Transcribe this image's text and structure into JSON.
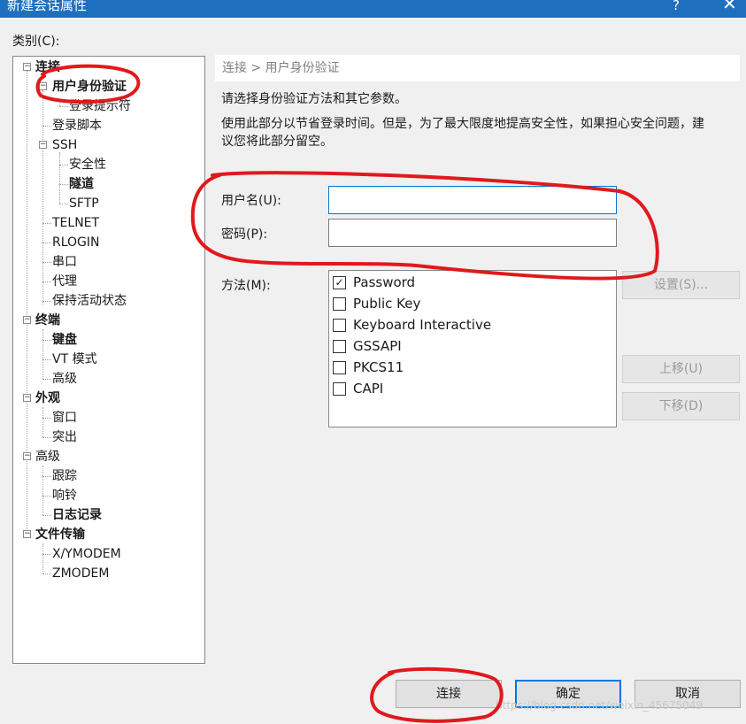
{
  "window": {
    "title": "新建会话属性",
    "help_glyph": "?",
    "close_glyph": "✕"
  },
  "category_label": "类别(C):",
  "tree": {
    "items": [
      {
        "label": "连接",
        "bold": true,
        "expander": "−"
      },
      {
        "label": "用户身份验证",
        "bold": true,
        "expander": "−",
        "selected": true
      },
      {
        "label": "登录提示符"
      },
      {
        "label": "登录脚本"
      },
      {
        "label": "SSH",
        "expander": "−"
      },
      {
        "label": "安全性"
      },
      {
        "label": "隧道",
        "bold": true
      },
      {
        "label": "SFTP"
      },
      {
        "label": "TELNET"
      },
      {
        "label": "RLOGIN"
      },
      {
        "label": "串口"
      },
      {
        "label": "代理"
      },
      {
        "label": "保持活动状态"
      },
      {
        "label": "终端",
        "bold": true,
        "expander": "−"
      },
      {
        "label": "键盘",
        "bold": true
      },
      {
        "label": "VT 模式"
      },
      {
        "label": "高级"
      },
      {
        "label": "外观",
        "bold": true,
        "expander": "−"
      },
      {
        "label": "窗口"
      },
      {
        "label": "突出"
      },
      {
        "label": "高级",
        "expander": "−"
      },
      {
        "label": "跟踪"
      },
      {
        "label": "响铃"
      },
      {
        "label": "日志记录",
        "bold": true
      },
      {
        "label": "文件传输",
        "bold": true,
        "expander": "−"
      },
      {
        "label": "X/YMODEM"
      },
      {
        "label": "ZMODEM"
      }
    ]
  },
  "breadcrumb": "连接 > 用户身份验证",
  "description": {
    "line1": "请选择身份验证方法和其它参数。",
    "line2": "使用此部分以节省登录时间。但是，为了最大限度地提高安全性，如果担心安全问题，建",
    "line3": "议您将此部分留空。"
  },
  "form": {
    "username_label": "用户名(U):",
    "username_value": "",
    "password_label": "密码(P):",
    "password_value": "",
    "method_label": "方法(M):"
  },
  "methods": [
    {
      "label": "Password",
      "checked": true
    },
    {
      "label": "Public Key",
      "checked": false
    },
    {
      "label": "Keyboard Interactive",
      "checked": false
    },
    {
      "label": "GSSAPI",
      "checked": false
    },
    {
      "label": "PKCS11",
      "checked": false
    },
    {
      "label": "CAPI",
      "checked": false
    }
  ],
  "side_buttons": {
    "settings": "设置(S)...",
    "move_up": "上移(U)",
    "move_down": "下移(D)"
  },
  "footer_buttons": {
    "connect": "连接",
    "ok": "确定",
    "cancel": "取消"
  },
  "watermark": "https://blog.csdn.net/weixin_45675049",
  "colors": {
    "titlebar": "#1f6fbf",
    "focus_border": "#0078d7",
    "annotation_red": "#e0191d"
  }
}
